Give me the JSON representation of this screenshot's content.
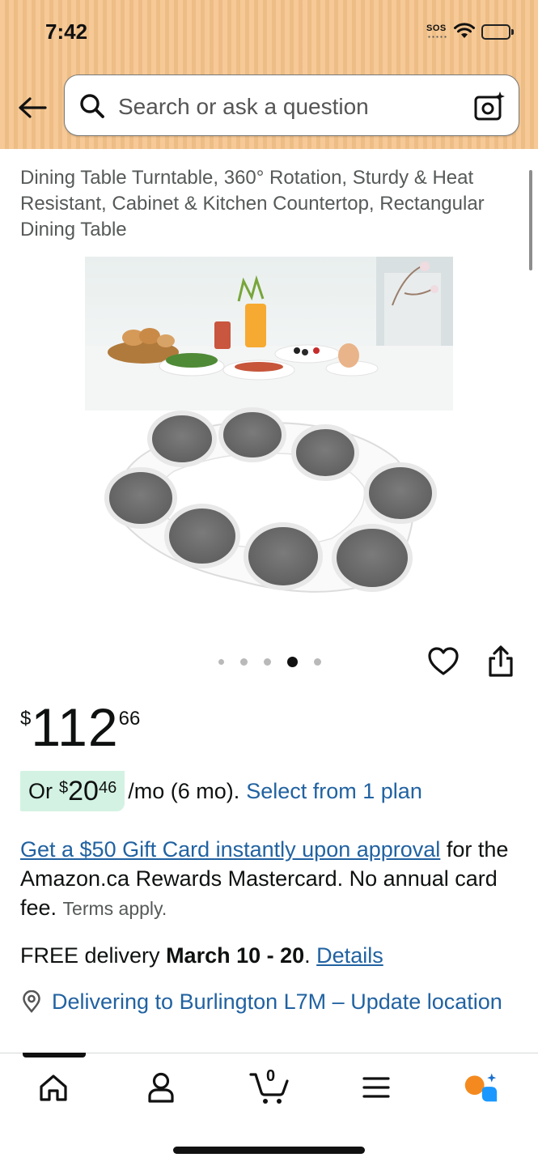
{
  "status_bar": {
    "time": "7:42",
    "sos": "SOS"
  },
  "search": {
    "placeholder": "Search or ask a question"
  },
  "product": {
    "title": "Dining Table Turntable, 360° Rotation, Sturdy & Heat Resistant, Cabinet & Kitchen Countertop, Rectangular Dining Table",
    "image_count": 5,
    "active_image_index": 4
  },
  "price": {
    "currency": "$",
    "whole": "112",
    "fraction": "66"
  },
  "plan": {
    "prefix": "Or",
    "currency": "$",
    "whole": "20",
    "fraction": "46",
    "suffix": "/mo (6 mo).",
    "link": "Select from 1 plan"
  },
  "gift": {
    "link": "Get a $50 Gift Card instantly upon approval",
    "text": " for the Amazon.ca Rewards Mastercard. No annual card fee. ",
    "terms": "Terms apply."
  },
  "delivery": {
    "prefix": "FREE delivery ",
    "dates": "March 10 - 20",
    "separator": ". ",
    "link": "Details"
  },
  "location": {
    "text": "Delivering to Burlington L7M – Update location"
  },
  "bottom_nav": {
    "items": [
      "home-icon",
      "account-icon",
      "cart-icon",
      "menu-icon",
      "rufus-ai-icon"
    ],
    "cart_count": "0",
    "active": "home"
  },
  "colors": {
    "header": "#f5c38a",
    "link": "#2162a1",
    "plan_badge": "#d3f2e3",
    "ai_orange": "#f48a1f",
    "ai_blue": "#1a98ff"
  }
}
